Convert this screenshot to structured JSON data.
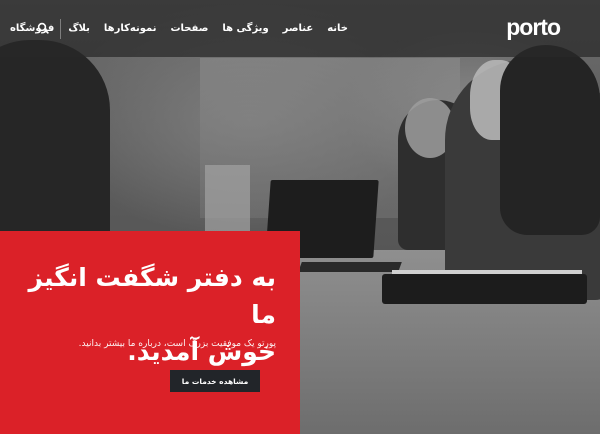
{
  "header": {
    "logo_text": "porto",
    "nav": [
      "خانه",
      "عناصر",
      "ویژگی ها",
      "صفحات",
      "نمونه‌کارها",
      "بلاگ",
      "فروشگاه"
    ],
    "search_icon": "search-icon"
  },
  "hero": {
    "headline_line1": "به دفتر شگفت انگیز ما",
    "headline_line2": "خوش آمدید.",
    "lead": "پورتو یک موفقیت بزرگ است، درباره ما بیشتر بدانید.",
    "cta_label": "مشاهده خدمات ما"
  },
  "colors": {
    "accent": "#db2128",
    "button_bg": "#222529",
    "header_bg": "#282828"
  }
}
